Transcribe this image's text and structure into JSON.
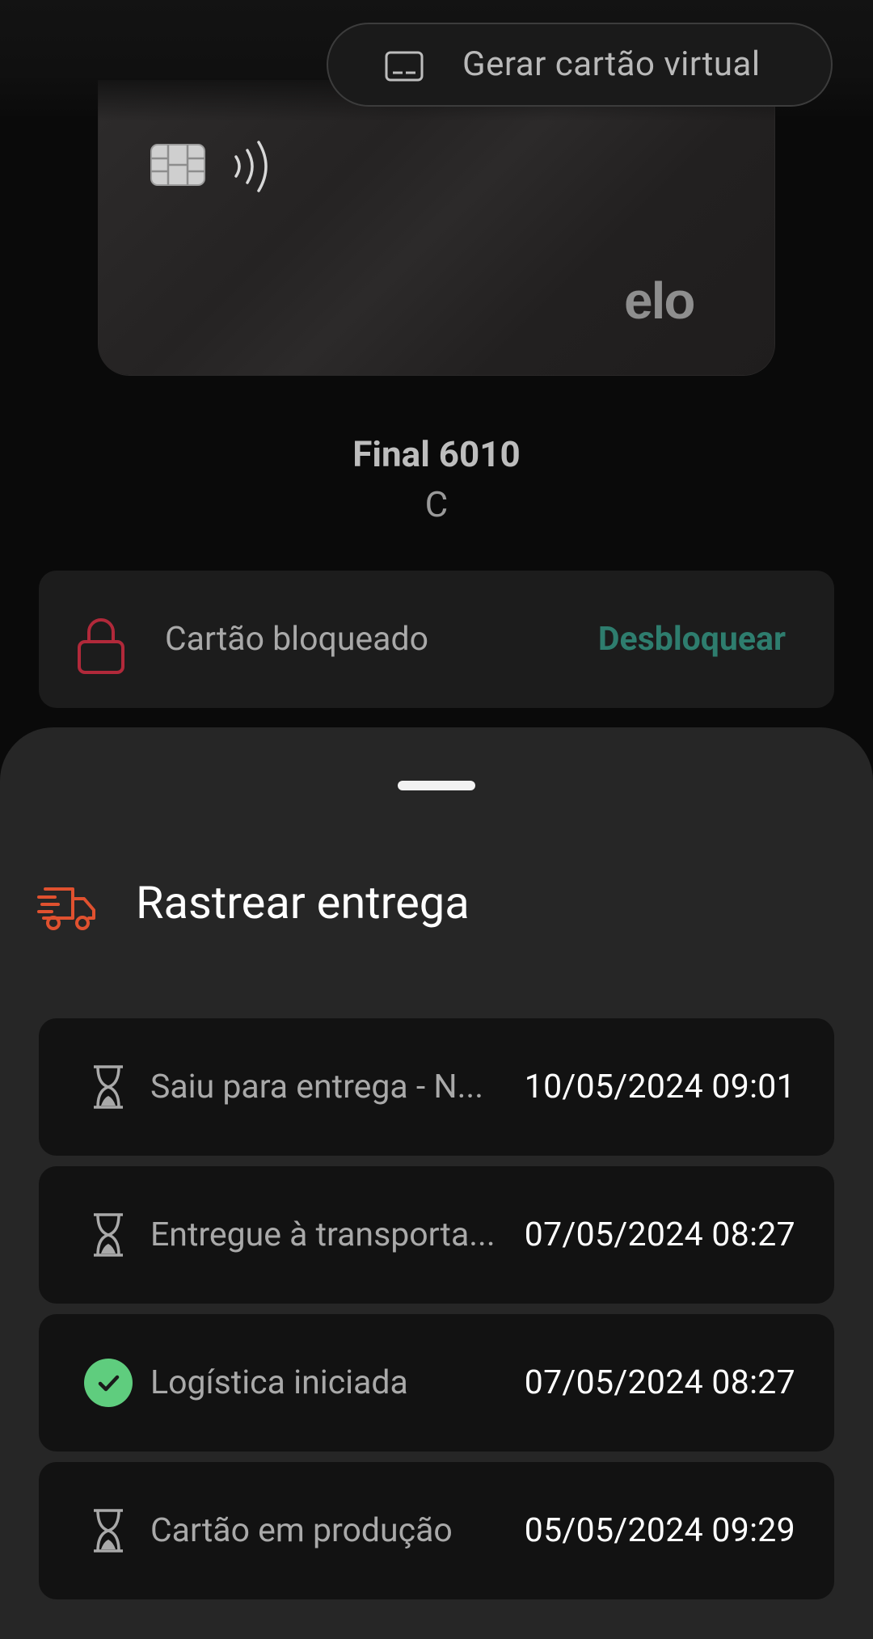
{
  "header": {
    "virtual_card_button": "Gerar cartão virtual",
    "virtual_card_icon": "card-outline-icon"
  },
  "card": {
    "brand": "elo",
    "final": "Final 6010",
    "holder": "C"
  },
  "block_status": {
    "status_label": "Cartão bloqueado",
    "action_label": "Desbloquear",
    "icon": "lock-icon",
    "icon_color": "#b1293a",
    "action_color": "#2e7d6e"
  },
  "tracking": {
    "title": "Rastrear entrega",
    "icon": "delivery-truck-icon",
    "icon_color": "#e0512f",
    "steps": [
      {
        "label": "Saiu para entrega - N...",
        "date": "10/05/2024 09:01",
        "state": "pending",
        "icon": "hourglass-icon"
      },
      {
        "label": "Entregue à transporta...",
        "date": "07/05/2024 08:27",
        "state": "pending",
        "icon": "hourglass-icon"
      },
      {
        "label": "Logística iniciada",
        "date": "07/05/2024 08:27",
        "state": "done",
        "icon": "check-circle-icon"
      },
      {
        "label": "Cartão em produção",
        "date": "05/05/2024 09:29",
        "state": "pending",
        "icon": "hourglass-icon"
      }
    ]
  },
  "colors": {
    "background": "#0a0a0a",
    "sheet": "#262626",
    "done": "#5fcd7e"
  }
}
